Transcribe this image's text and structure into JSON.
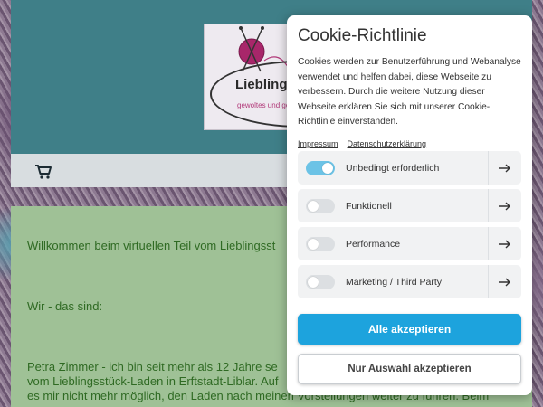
{
  "site": {
    "logo": {
      "name": "Lieblingsst",
      "tagline": "gewoltes und geb"
    },
    "content": {
      "line1": "Willkommen beim virtuellen Teil vom Lieblingsst",
      "line2": "Wir - das sind:",
      "line3": "Petra Zimmer - ich bin seit  mehr als 12 Jahre se",
      "line4": "vom Lieblingsstück-Laden in Erftstadt-Liblar. Auf",
      "line5": "es mir nicht mehr möglich, den Laden nach meinen Vorstellungen weiter zu führen. Beim"
    },
    "colors": {
      "header": "#3f7f88",
      "content_bg": "#9fc196",
      "content_text": "#2f6a23"
    }
  },
  "cookie_modal": {
    "title": "Cookie-Richtlinie",
    "text": "Cookies werden zur Benutzerführung und Webanalyse verwendet und helfen dabei, diese Webseite zu verbessern. Durch die weitere Nutzung dieser Webseite erklären Sie sich mit unserer Cookie-Richtlinie einverstanden.",
    "links": {
      "impressum": "Impressum",
      "datenschutz": "Datenschutzerklärung"
    },
    "options": [
      {
        "label": "Unbedingt erforderlich",
        "enabled": true
      },
      {
        "label": "Funktionell",
        "enabled": false
      },
      {
        "label": "Performance",
        "enabled": false
      },
      {
        "label": "Marketing / Third Party",
        "enabled": false
      }
    ],
    "accept_all": "Alle akzeptieren",
    "accept_selection": "Nur Auswahl akzeptieren",
    "colors": {
      "accent": "#1da3dd",
      "toggle_on": "#6cc3e6"
    }
  }
}
